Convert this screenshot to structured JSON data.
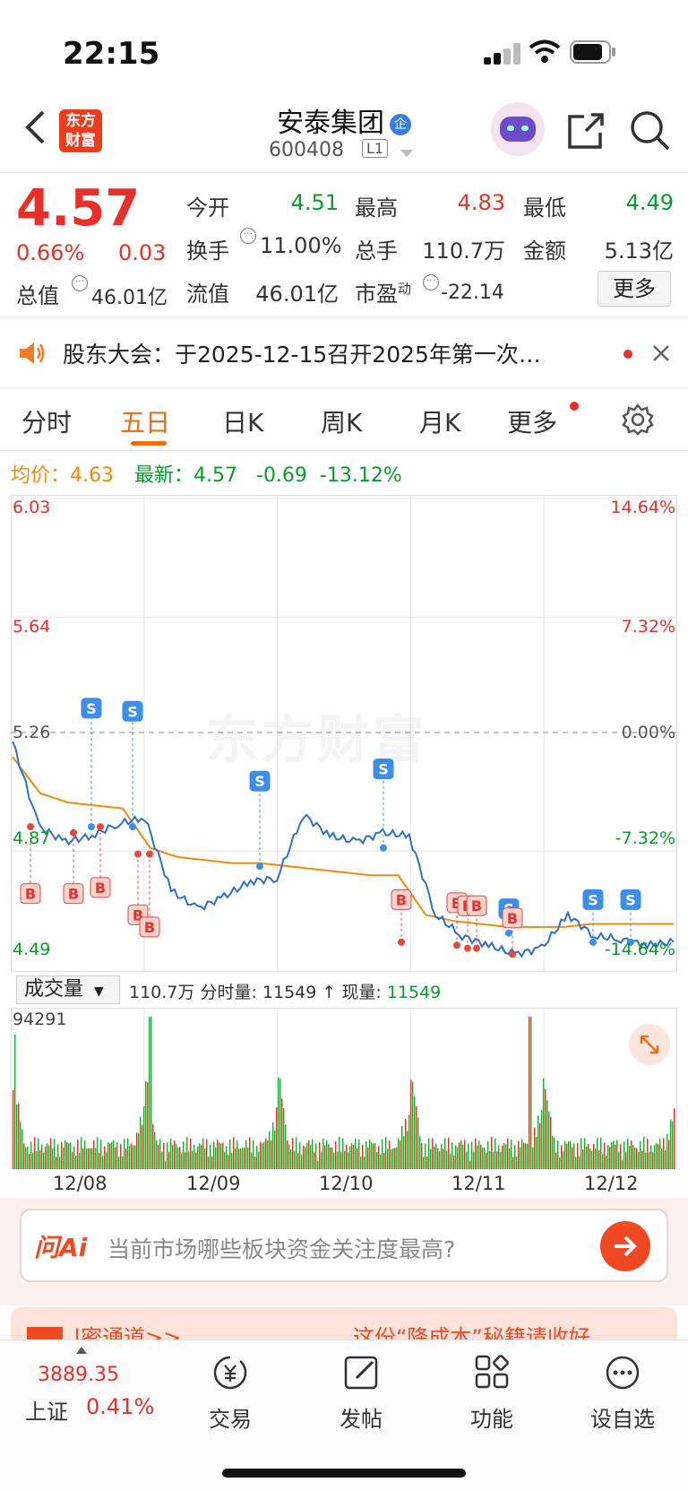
{
  "status": {
    "time": "22:15"
  },
  "nav": {
    "title": "安泰集团",
    "badge": "企",
    "code": "600408",
    "level": "L1",
    "logo_line1": "东方",
    "logo_line2": "财富"
  },
  "quote": {
    "price": "4.57",
    "pct": "0.66%",
    "chg": "0.03",
    "open_label": "今开",
    "open": "4.51",
    "high_label": "最高",
    "high": "4.83",
    "low_label": "最低",
    "low": "4.49",
    "turnover_label": "换手",
    "turnover": "11.00%",
    "vol_label": "总手",
    "vol": "110.7万",
    "amt_label": "金额",
    "amt": "5.13亿",
    "mktcap_label": "总值",
    "mktcap": "46.01亿",
    "float_label": "流值",
    "float": "46.01亿",
    "pe_label": "市盈",
    "pe_sup": "动",
    "pe": "-22.14",
    "more": "更多"
  },
  "notice": {
    "text": "股东大会：于2025-12-15召开2025年第一次…"
  },
  "tabs": [
    "分时",
    "五日",
    "日K",
    "周K",
    "月K",
    "更多"
  ],
  "avg": {
    "avg_label": "均价：",
    "avg": "4.63",
    "latest_label": "最新：",
    "latest": "4.57",
    "change": "-0.69",
    "pct": "-13.12%"
  },
  "chart_data": {
    "type": "line",
    "title": "",
    "x": [
      "12/08",
      "12/09",
      "12/10",
      "12/11",
      "12/12"
    ],
    "series": [
      {
        "name": "价格",
        "values": [
          5.23,
          4.95,
          4.9,
          4.92,
          4.96,
          4.98,
          4.74,
          4.68,
          4.72,
          4.77,
          4.78,
          4.99,
          4.92,
          4.9,
          4.93,
          4.92,
          4.66,
          4.59,
          4.56,
          4.53,
          4.55,
          4.66,
          4.59,
          4.58,
          4.56,
          4.57
        ]
      },
      {
        "name": "均价",
        "values": [
          5.18,
          5.06,
          5.03,
          5.02,
          5.01,
          4.88,
          4.85,
          4.84,
          4.83,
          4.83,
          4.82,
          4.81,
          4.8,
          4.79,
          4.79,
          4.66,
          4.64,
          4.63,
          4.62,
          4.62,
          4.62,
          4.63,
          4.63,
          4.63,
          4.63
        ]
      }
    ],
    "y_left": [
      "6.03",
      "5.64",
      "5.26",
      "4.87",
      "4.49"
    ],
    "y_right": [
      "14.64%",
      "7.32%",
      "0.00%",
      "-7.32%",
      "-14.64%"
    ],
    "ylim": [
      4.49,
      6.03
    ],
    "prev_close": 5.26
  },
  "volume": {
    "selector": "成交量",
    "total": "110.7万",
    "tick_label": "分时量:",
    "tick": "11549",
    "now_label": "现量:",
    "now": "11549",
    "max": "94291"
  },
  "dates": [
    "12/08",
    "12/09",
    "12/10",
    "12/11",
    "12/12"
  ],
  "ai": {
    "placeholder": "当前市场哪些板块资金关注度最高?",
    "brand": "问Ai"
  },
  "banner": {
    "left": "|密通道>>",
    "right": "这份“降成本”秘籍请收好"
  },
  "bottom": {
    "index_value": "3889.35",
    "index_name": "上证",
    "index_pct": "0.41%",
    "items": [
      "交易",
      "发帖",
      "功能",
      "设自选"
    ]
  }
}
